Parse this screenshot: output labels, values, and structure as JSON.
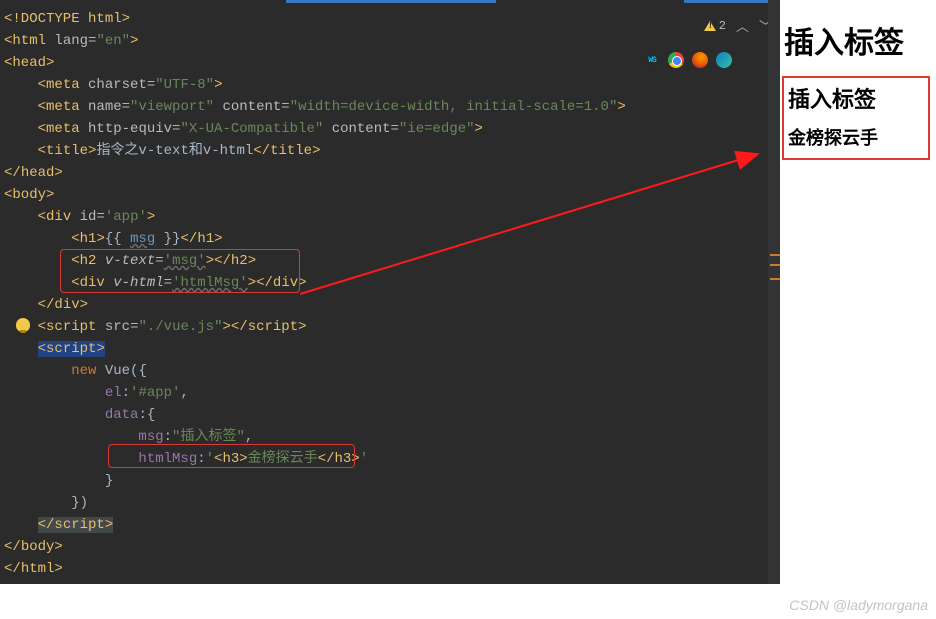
{
  "status": {
    "warn_count": "2"
  },
  "preview": {
    "h1": "插入标签",
    "h2": "插入标签",
    "h3": "金榜探云手"
  },
  "code": {
    "l1_doctype": "<!DOCTYPE html>",
    "l2_a": "<",
    "l2_tag": "html",
    "l2_sp": " ",
    "l2_attr": "lang",
    "l2_eq": "=",
    "l2_val": "\"en\"",
    "l2_b": ">",
    "l3_a": "<",
    "l3_tag": "head",
    "l3_b": ">",
    "l4_a": "<",
    "l4_tag": "meta",
    "l4_sp": " ",
    "l4_attr": "charset",
    "l4_val": "\"UTF-8\"",
    "l4_b": ">",
    "l5_a": "<",
    "l5_tag": "meta",
    "l5_sp": " ",
    "l5_attr1": "name",
    "l5_val1": "\"viewport\"",
    "l5_attr2": "content",
    "l5_val2": "\"width=device-width, initial-scale=1.0\"",
    "l5_b": ">",
    "l6_a": "<",
    "l6_tag": "meta",
    "l6_sp": " ",
    "l6_attr1": "http-equiv",
    "l6_val1": "\"X-UA-Compatible\"",
    "l6_attr2": "content",
    "l6_val2": "\"ie=edge\"",
    "l6_b": ">",
    "l7_a": "<",
    "l7_tag": "title",
    "l7_b": ">",
    "l7_txt": "指令之v-text和v-html",
    "l7_c": "</",
    "l7_d": ">",
    "l8_a": "</",
    "l8_tag": "head",
    "l8_b": ">",
    "l9_a": "<",
    "l9_tag": "body",
    "l9_b": ">",
    "l10_a": "<",
    "l10_tag": "div",
    "l10_sp": " ",
    "l10_attr": "id",
    "l10_val": "'app'",
    "l10_b": ">",
    "l11_a": "<",
    "l11_tag": "h1",
    "l11_b": ">",
    "l11_m1": "{{ ",
    "l11_msg": "msg",
    "l11_m2": " }}",
    "l11_c": "</",
    "l11_d": ">",
    "l12_a": "<",
    "l12_tag": "h2",
    "l12_sp": " ",
    "l12_attr": "v-text",
    "l12_val": "'msg'",
    "l12_b": "></",
    "l12_c": ">",
    "l13_a": "<",
    "l13_tag": "div",
    "l13_sp": " ",
    "l13_attr": "v-html",
    "l13_val": "'htmlMsg'",
    "l13_b": "></",
    "l13_c": ">",
    "l14_a": "</",
    "l14_tag": "div",
    "l14_b": ">",
    "l15_a": "<",
    "l15_tag": "script",
    "l15_sp": " ",
    "l15_attr": "src",
    "l15_val": "\"./vue.js\"",
    "l15_b": "></",
    "l15_c": ">",
    "l16_a": "<",
    "l16_tag": "script",
    "l16_b": ">",
    "l17_kw": "new",
    "l17_sp": " ",
    "l17_vue": "Vue({",
    "l18_el": "el",
    "l18_c": ":",
    "l18_v": "'#app'",
    "l18_cm": ",",
    "l19_data": "data",
    "l19_c": ":{",
    "l20_msg": "msg",
    "l20_c": ":",
    "l20_v": "\"插入标签\"",
    "l20_cm": ",",
    "l21_hm": "htmlMsg",
    "l21_c": ":",
    "l21_q1": "'",
    "l21_a": "<",
    "l21_tag": "h3",
    "l21_b": ">",
    "l21_txt": "金榜探云手",
    "l21_c2": "</",
    "l21_d": ">",
    "l21_q2": "'",
    "l22": "}",
    "l23": "})",
    "l24_a": "</",
    "l24_tag": "script",
    "l24_b": ">",
    "l25_a": "</",
    "l25_tag": "body",
    "l25_b": ">",
    "l26_a": "</",
    "l26_tag": "html",
    "l26_b": ">"
  },
  "watermark": "CSDN @ladymorgana"
}
